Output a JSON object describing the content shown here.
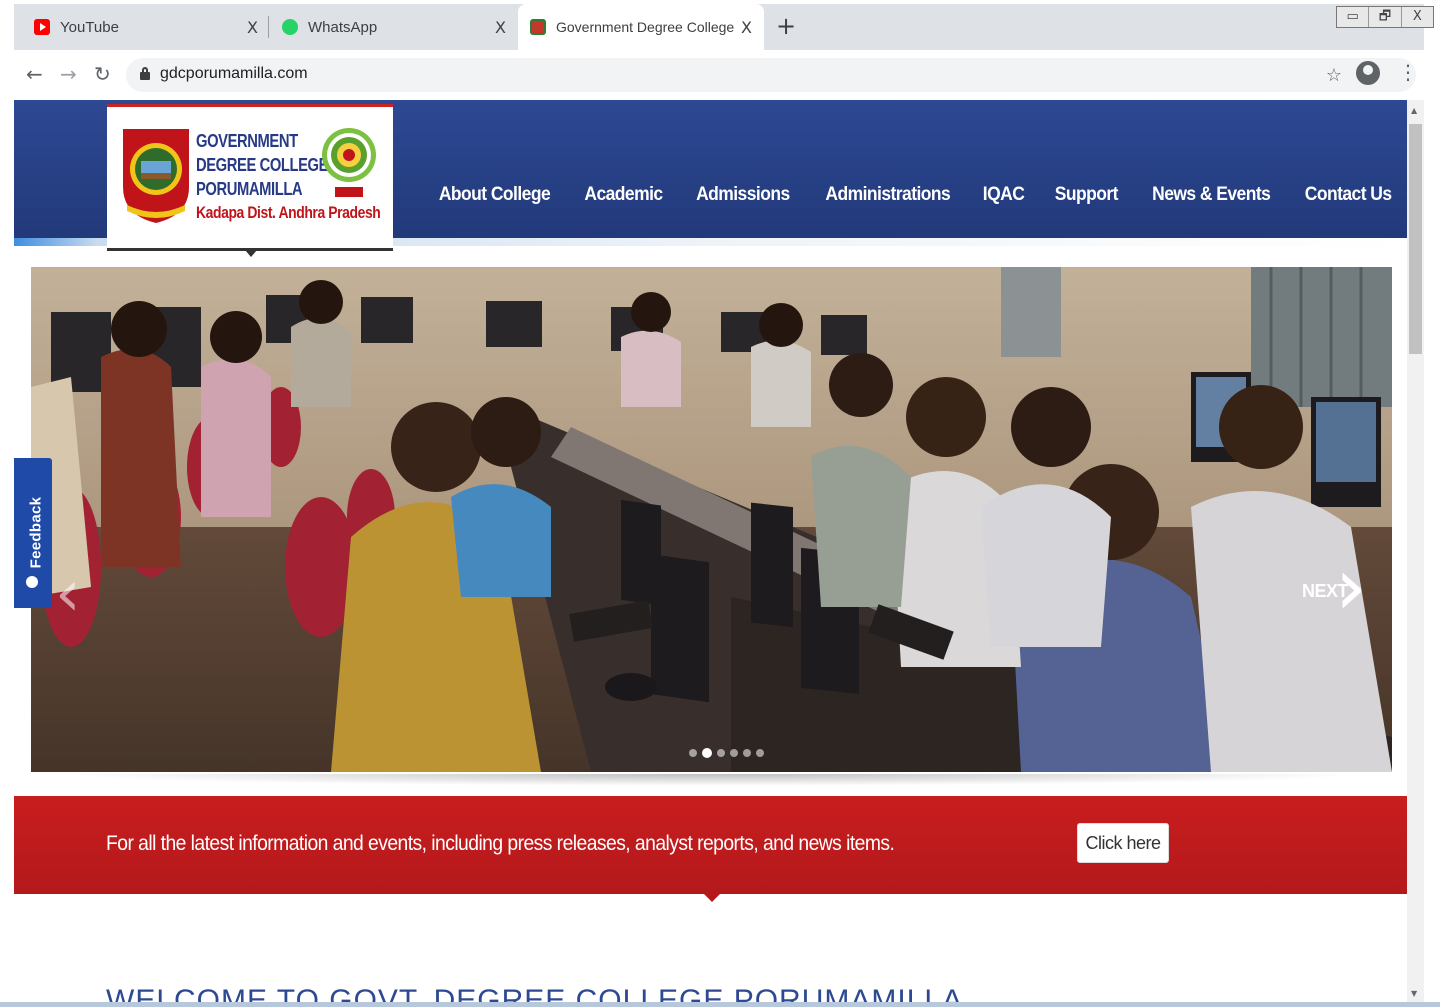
{
  "browser": {
    "tabs": [
      {
        "title": "YouTube",
        "icon": "youtube-icon",
        "color": "#ff0000"
      },
      {
        "title": "WhatsApp",
        "icon": "whatsapp-icon",
        "color": "#25d366"
      },
      {
        "title": "Government Degree College Pon",
        "icon": "college-seal-icon",
        "active": true
      }
    ],
    "tab_close": "X",
    "new_tab": "+",
    "url": "gdcporumamilla.com",
    "window_controls": {
      "minimize": "▭",
      "restore": "🗗",
      "close": "X"
    }
  },
  "header": {
    "logo": {
      "line1": "GOVERNMENT",
      "line2": "DEGREE COLLEGE",
      "line3": "PORUMAMILLA",
      "line4": "Kadapa Dist. Andhra Pradesh"
    },
    "nav": [
      "About College",
      "Academic",
      "Admissions",
      "Administrations",
      "IQAC",
      "Support",
      "News & Events",
      "Contact Us"
    ]
  },
  "slider": {
    "next_label": "NEXT",
    "slide_count": 6,
    "active_slide": 2
  },
  "feedback": {
    "label": "Feedback"
  },
  "banner": {
    "text": "For all the latest information and events, including press releases, analyst reports, and news items.",
    "button": "Click here"
  },
  "welcome": {
    "title": "WELCOME TO GOVT. DEGREE COLLEGE PORUMAMILLA"
  },
  "colors": {
    "header_blue": "#2d4993",
    "banner_red": "#c91d1f"
  }
}
